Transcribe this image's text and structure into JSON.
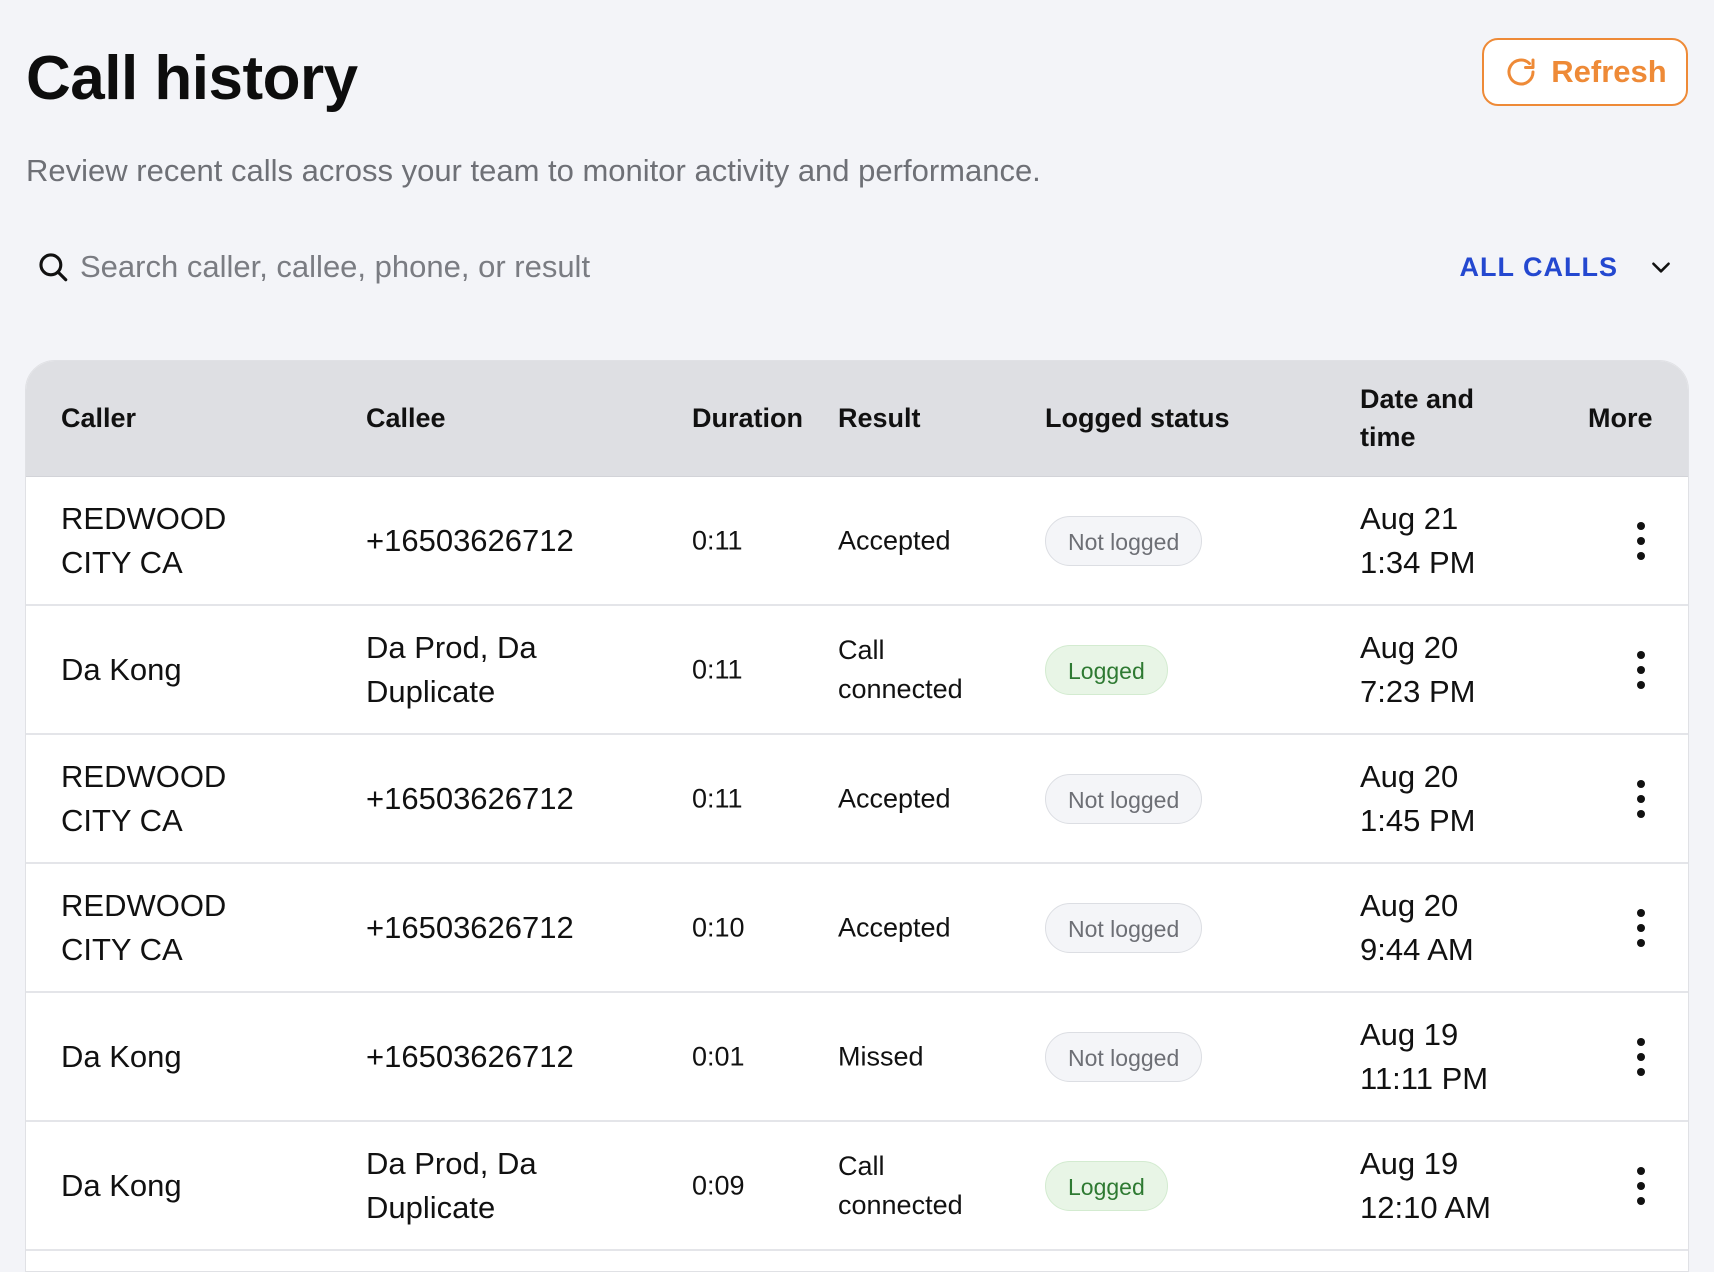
{
  "header": {
    "title": "Call history",
    "subtitle": "Review recent calls across your team to monitor activity and performance.",
    "refresh_label": "Refresh"
  },
  "search": {
    "placeholder": "Search caller, callee, phone, or result",
    "value": ""
  },
  "filter": {
    "selected": "ALL CALLS"
  },
  "table": {
    "columns": {
      "caller": "Caller",
      "callee": "Callee",
      "duration": "Duration",
      "result": "Result",
      "logged_status": "Logged status",
      "date_time_line1": "Date and",
      "date_time_line2": "time",
      "more": "More"
    },
    "rows": [
      {
        "caller": [
          "REDWOOD",
          "CITY CA"
        ],
        "callee": [
          "+16503626712"
        ],
        "duration": "0:11",
        "result": [
          "Accepted"
        ],
        "logged_status": "Not logged",
        "date": "Aug 21",
        "time": "1:34 PM"
      },
      {
        "caller": [
          "Da Kong"
        ],
        "callee": [
          "Da Prod, Da",
          "Duplicate"
        ],
        "duration": "0:11",
        "result": [
          "Call",
          "connected"
        ],
        "logged_status": "Logged",
        "date": "Aug 20",
        "time": "7:23 PM"
      },
      {
        "caller": [
          "REDWOOD",
          "CITY CA"
        ],
        "callee": [
          "+16503626712"
        ],
        "duration": "0:11",
        "result": [
          "Accepted"
        ],
        "logged_status": "Not logged",
        "date": "Aug 20",
        "time": "1:45 PM"
      },
      {
        "caller": [
          "REDWOOD",
          "CITY CA"
        ],
        "callee": [
          "+16503626712"
        ],
        "duration": "0:10",
        "result": [
          "Accepted"
        ],
        "logged_status": "Not logged",
        "date": "Aug 20",
        "time": "9:44 AM"
      },
      {
        "caller": [
          "Da Kong"
        ],
        "callee": [
          "+16503626712"
        ],
        "duration": "0:01",
        "result": [
          "Missed"
        ],
        "logged_status": "Not logged",
        "date": "Aug 19",
        "time": "11:11 PM"
      },
      {
        "caller": [
          "Da Kong"
        ],
        "callee": [
          "Da Prod, Da",
          "Duplicate"
        ],
        "duration": "0:09",
        "result": [
          "Call",
          "connected"
        ],
        "logged_status": "Logged",
        "date": "Aug 19",
        "time": "12:10 AM"
      }
    ]
  },
  "icons": {
    "refresh": "refresh-icon",
    "search": "search-icon",
    "dropdown": "chevron-down-icon",
    "more": "more-vertical-icon"
  },
  "colors": {
    "accent_orange": "#ee8a37",
    "link_blue": "#2448d0",
    "logged_green": "#2e7a32",
    "logged_bg": "#e8f5e6",
    "not_logged_text": "#6d6f75",
    "header_bg": "#dedfe3",
    "page_bg": "#f3f4f8"
  }
}
